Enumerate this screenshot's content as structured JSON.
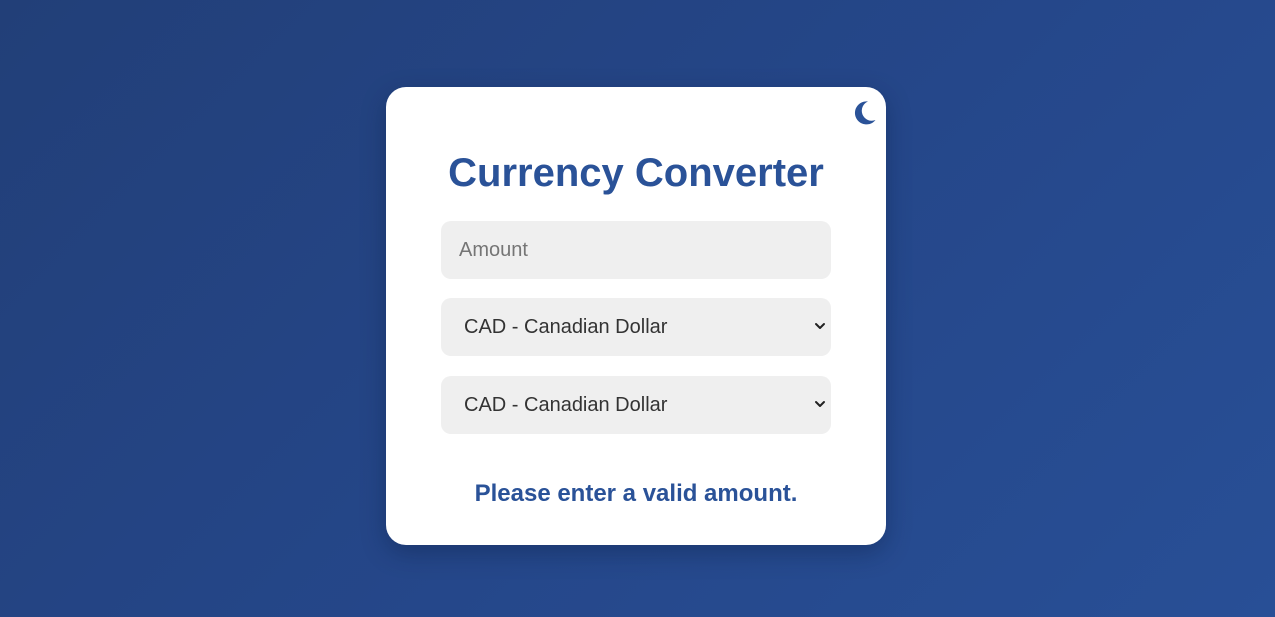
{
  "app": {
    "title": "Currency Converter"
  },
  "theme_toggle": {
    "icon": "moon-icon"
  },
  "form": {
    "amount": {
      "placeholder": "Amount",
      "value": ""
    },
    "from_currency": {
      "selected": "CAD - Canadian Dollar"
    },
    "to_currency": {
      "selected": "CAD - Canadian Dollar"
    }
  },
  "result": {
    "message": "Please enter a valid amount."
  },
  "colors": {
    "background_gradient_start": "#223f78",
    "background_gradient_end": "#284f96",
    "accent": "#2a5298",
    "field_background": "#efefef",
    "card_background": "#ffffff"
  }
}
